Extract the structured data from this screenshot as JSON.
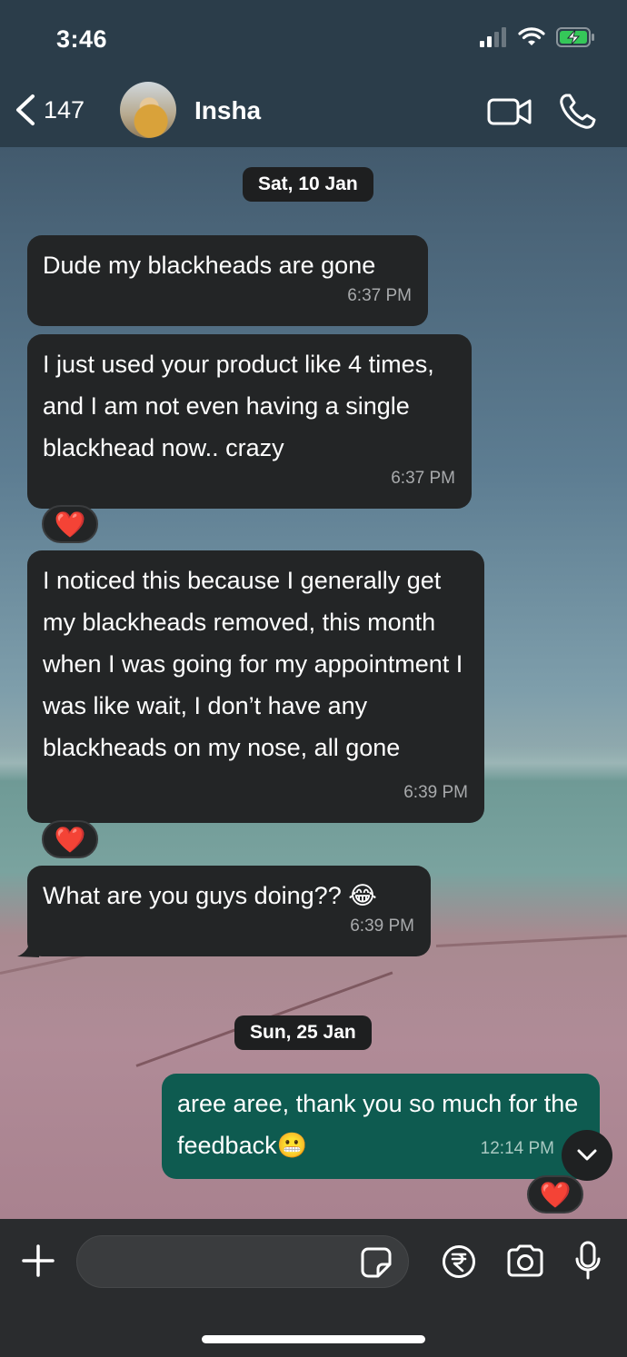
{
  "status_bar": {
    "time": "3:46"
  },
  "header": {
    "back_count": "147",
    "contact_name": "Insha"
  },
  "chips": {
    "date_1": "Sat, 10 Jan",
    "date_2": "Sun, 25 Jan"
  },
  "messages": [
    {
      "direction": "incoming",
      "text": "Dude my blackheads are gone",
      "time": "6:37 PM"
    },
    {
      "direction": "incoming",
      "text": "I just used your product like 4 times, and I am not even having a single blackhead now.. crazy",
      "time": "6:37 PM",
      "reaction": "❤️"
    },
    {
      "direction": "incoming",
      "text": "I noticed this because I generally get my blackheads removed, this month when I was going for my appointment I was like wait, I don’t have any blackheads on my nose, all gone",
      "time": "6:39 PM",
      "reaction": "❤️"
    },
    {
      "direction": "incoming",
      "text": "What are you guys doing?? 😂",
      "time": "6:39 PM"
    },
    {
      "direction": "outgoing",
      "text": "aree aree, thank you so much for the feedback😬",
      "time": "12:14 PM",
      "reaction": "❤️"
    }
  ],
  "composer": {
    "placeholder": ""
  },
  "icons": {
    "back": "chevron-left-icon",
    "video": "video-camera-icon",
    "call": "phone-icon",
    "add": "plus-icon",
    "sticker": "sticker-icon",
    "payment": "rupee-icon",
    "camera": "camera-icon",
    "mic": "microphone-icon",
    "scroll": "chevron-down-icon"
  },
  "colors": {
    "incoming_bubble": "#232526",
    "outgoing_bubble": "#0e5b50",
    "header": "#2b3d4a",
    "battery_charging": "#35c759"
  }
}
